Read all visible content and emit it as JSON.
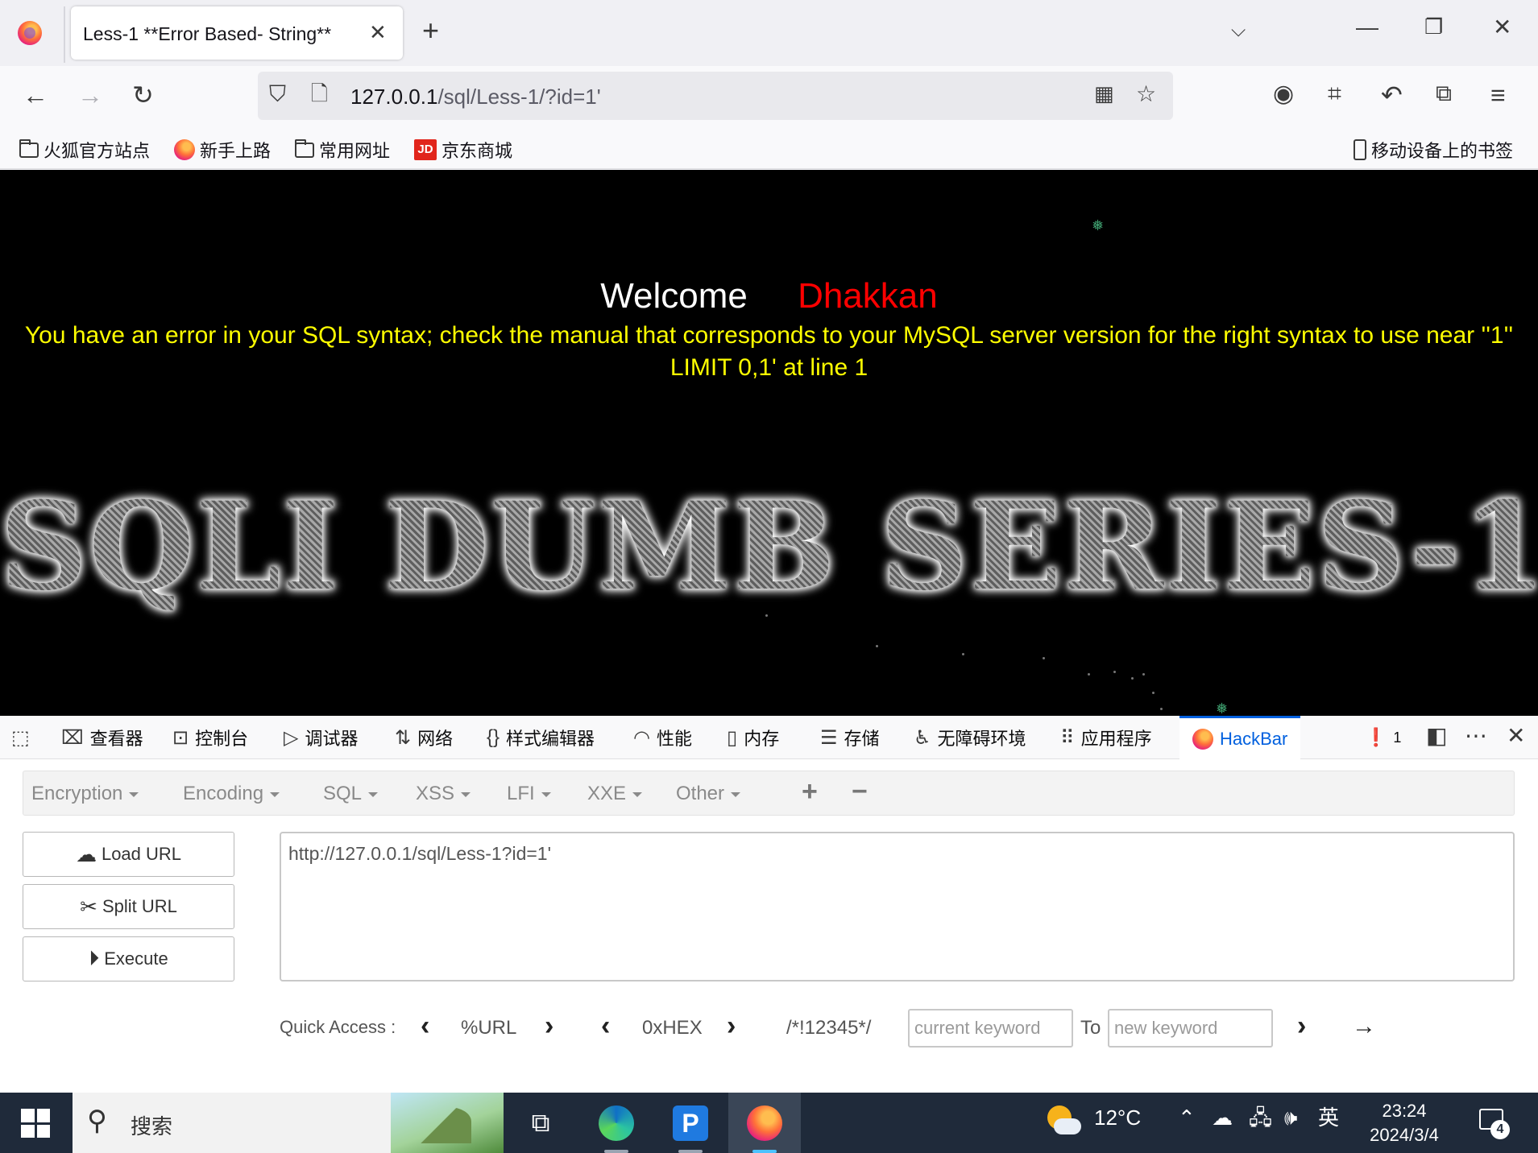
{
  "browser": {
    "tab_title": "Less-1 **Error Based- String**",
    "url_host": "127.0.0.1",
    "url_path": "/sql/Less-1/?id=1'",
    "bookmarks": [
      "火狐官方站点",
      "新手上路",
      "常用网址",
      "京东商城"
    ],
    "mobile_bookmarks": "移动设备上的书签",
    "jd_badge": "JD"
  },
  "page": {
    "welcome": "Welcome",
    "name": "Dhakkan",
    "error": "You have an error in your SQL syntax; check the manual that corresponds to your MySQL server version for the right syntax to use near ''1'' LIMIT 0,1' at line 1",
    "banner": "SQLI DUMB SERIES-1"
  },
  "devtools": {
    "tabs": [
      "查看器",
      "控制台",
      "调试器",
      "网络",
      "样式编辑器",
      "性能",
      "内存",
      "存储",
      "无障碍环境",
      "应用程序",
      "HackBar"
    ],
    "error_count": "1"
  },
  "hackbar": {
    "menu": [
      "Encryption",
      "Encoding",
      "SQL",
      "XSS",
      "LFI",
      "XXE",
      "Other"
    ],
    "load_url": "Load URL",
    "split_url": "Split URL",
    "execute": "Execute",
    "url_value": "http://127.0.0.1/sql/Less-1?id=1'",
    "quick_access_label": "Quick Access :",
    "qa_url": "%URL",
    "qa_hex": "0xHEX",
    "qa_comment": "/*!12345*/",
    "current_keyword_placeholder": "current keyword",
    "to_label": "To",
    "new_keyword_placeholder": "new keyword"
  },
  "taskbar": {
    "search": "搜索",
    "temperature": "12°C",
    "ime": "英",
    "time": "23:24",
    "date": "2024/3/4",
    "notification_count": "4",
    "pinned_p": "P"
  },
  "colors": {
    "accent": "#0060df",
    "sql_error": "#ffff00",
    "name": "#ff0000",
    "taskbar": "#1f2a3a"
  }
}
